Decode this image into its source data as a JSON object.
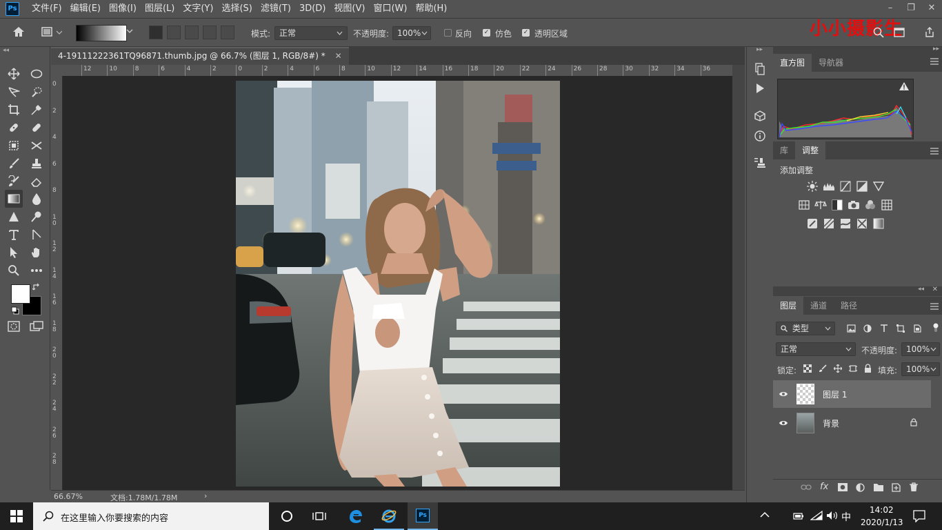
{
  "app": {
    "logo_text": "Ps"
  },
  "menu": {
    "items": [
      "文件(F)",
      "编辑(E)",
      "图像(I)",
      "图层(L)",
      "文字(Y)",
      "选择(S)",
      "滤镜(T)",
      "3D(D)",
      "视图(V)",
      "窗口(W)",
      "帮助(H)"
    ]
  },
  "window_controls": {
    "minimize": "–",
    "restore": "❐",
    "close": "✕"
  },
  "options": {
    "mode_label": "模式:",
    "mode_value": "正常",
    "opacity_label": "不透明度:",
    "opacity_value": "100%",
    "reverse_label": "反向",
    "reverse_checked": false,
    "dither_label": "仿色",
    "dither_checked": true,
    "transparency_label": "透明区域",
    "transparency_checked": true
  },
  "watermark": "小小摄影生",
  "document": {
    "tab_title": "4-19111222361TQ96871.thumb.jpg @ 66.7% (图层 1, RGB/8#) *",
    "close_glyph": "✕"
  },
  "ruler": {
    "h_labels": [
      "12",
      "10",
      "8",
      "6",
      "4",
      "2",
      "0",
      "2",
      "4",
      "6",
      "8",
      "10",
      "12",
      "14",
      "16",
      "18",
      "20",
      "22",
      "24",
      "26",
      "28",
      "30",
      "32",
      "34",
      "36"
    ],
    "v_labels": [
      "0",
      "2",
      "4",
      "6",
      "8",
      "1\n0",
      "1\n2",
      "1\n4",
      "1\n6",
      "1\n8",
      "2\n0",
      "2\n2",
      "2\n4",
      "2\n6",
      "2\n8"
    ]
  },
  "status": {
    "zoom": "66.67%",
    "doc_info": "文档:1.78M/1.78M",
    "arrow": "›"
  },
  "panels": {
    "histogram_tab": "直方图",
    "navigator_tab": "导航器",
    "library_tab": "库",
    "adjustments_tab": "调整",
    "add_adjustment": "添加调整",
    "layers_tab": "图层",
    "channels_tab": "通道",
    "paths_tab": "路径",
    "filter_kind": "类型",
    "blend_mode": "正常",
    "opacity_label": "不透明度:",
    "opacity_value": "100%",
    "lock_label": "锁定:",
    "fill_label": "填充:",
    "fill_value": "100%",
    "layers": [
      {
        "name": "图层 1",
        "selected": true,
        "locked": false
      },
      {
        "name": "背景",
        "selected": false,
        "locked": true
      }
    ]
  },
  "taskbar": {
    "search_placeholder": "在这里输入你要搜索的内容",
    "time": "14:02",
    "date": "2020/1/13",
    "ime": "中"
  },
  "colors": {
    "ui_bg": "#535353",
    "canvas_bg": "#282828",
    "watermark": "#e01010",
    "ps_blue": "#31a8ff"
  }
}
